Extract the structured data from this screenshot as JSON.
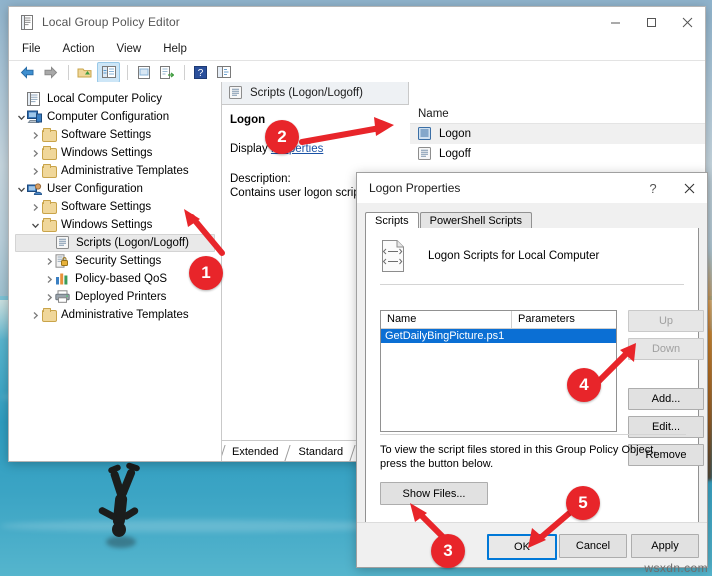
{
  "desktop": {
    "watermark": "wsxdn.com"
  },
  "gpe_window": {
    "title": "Local Group Policy Editor",
    "title_icon": "policy-editor-icon",
    "window_buttons": [
      {
        "name": "minimize-button",
        "glyph": "minimize"
      },
      {
        "name": "maximize-button",
        "glyph": "maximize"
      },
      {
        "name": "close-button",
        "glyph": "close"
      }
    ],
    "menus": [
      "File",
      "Action",
      "View",
      "Help"
    ],
    "toolbar": [
      {
        "name": "back-button",
        "icon": "back-arrow-icon"
      },
      {
        "name": "forward-button",
        "icon": "forward-arrow-icon"
      },
      {
        "name": "up-folder-button",
        "icon": "up-folder-icon"
      },
      {
        "name": "show-tree-button",
        "icon": "show-tree-icon",
        "selected": true
      },
      {
        "name": "properties-button",
        "icon": "properties-icon"
      },
      {
        "name": "export-list-button",
        "icon": "export-list-icon"
      },
      {
        "name": "help-button",
        "icon": "help-icon"
      },
      {
        "name": "show-details-button",
        "icon": "show-details-icon"
      }
    ],
    "tree": [
      {
        "label": "Local Computer Policy",
        "depth": 0,
        "chevron": "",
        "icon": "policy-icon",
        "selected": false
      },
      {
        "label": "Computer Configuration",
        "depth": 0,
        "chevron": "expanded",
        "icon": "computer-icon",
        "selected": false
      },
      {
        "label": "Software Settings",
        "depth": 1,
        "chevron": "collapsed",
        "icon": "folder-icon",
        "selected": false
      },
      {
        "label": "Windows Settings",
        "depth": 1,
        "chevron": "collapsed",
        "icon": "folder-icon",
        "selected": false
      },
      {
        "label": "Administrative Templates",
        "depth": 1,
        "chevron": "collapsed",
        "icon": "folder-icon",
        "selected": false
      },
      {
        "label": "User Configuration",
        "depth": 0,
        "chevron": "expanded",
        "icon": "user-icon",
        "selected": false
      },
      {
        "label": "Software Settings",
        "depth": 1,
        "chevron": "collapsed",
        "icon": "folder-icon",
        "selected": false
      },
      {
        "label": "Windows Settings",
        "depth": 1,
        "chevron": "expanded",
        "icon": "folder-icon",
        "selected": false
      },
      {
        "label": "Scripts (Logon/Logoff)",
        "depth": 2,
        "chevron": "",
        "icon": "scripts-icon",
        "selected": true
      },
      {
        "label": "Security Settings",
        "depth": 2,
        "chevron": "collapsed",
        "icon": "security-icon",
        "selected": false
      },
      {
        "label": "Policy-based QoS",
        "depth": 2,
        "chevron": "collapsed",
        "icon": "qos-icon",
        "selected": false
      },
      {
        "label": "Deployed Printers",
        "depth": 2,
        "chevron": "collapsed",
        "icon": "printer-icon",
        "selected": false
      },
      {
        "label": "Administrative Templates",
        "depth": 1,
        "chevron": "collapsed",
        "icon": "folder-icon",
        "selected": false
      }
    ],
    "right_pane": {
      "tab_label": "Scripts (Logon/Logoff)",
      "tab_icon": "scripts-icon",
      "heading": "Logon",
      "display_label": "Display",
      "display_link": "Properties",
      "description_label": "Description:",
      "description_text": "Contains user logon scripts.",
      "column_header": "Name",
      "items": [
        {
          "label": "Logon",
          "icon": "logon-script-icon",
          "highlighted": true
        },
        {
          "label": "Logoff",
          "icon": "logoff-script-icon",
          "highlighted": false
        }
      ]
    },
    "bottom_tabs": [
      {
        "label": "Extended",
        "active": false
      },
      {
        "label": "Standard",
        "active": true
      }
    ]
  },
  "dialog": {
    "title": "Logon Properties",
    "help_button": "?",
    "close_button": "close-icon",
    "tabs": [
      {
        "label": "Scripts",
        "active": true
      },
      {
        "label": "PowerShell Scripts",
        "active": false
      }
    ],
    "header_text": "Logon Scripts for Local Computer",
    "header_icon": "script-document-icon",
    "list_columns": [
      "Name",
      "Parameters"
    ],
    "list_rows": [
      {
        "name": "GetDailyBingPicture.ps1",
        "parameters": "",
        "selected": true
      }
    ],
    "side_buttons": [
      {
        "label": "Up",
        "enabled": false
      },
      {
        "label": "Down",
        "enabled": false
      },
      {
        "label": "Add...",
        "enabled": true
      },
      {
        "label": "Edit...",
        "enabled": true
      },
      {
        "label": "Remove",
        "enabled": true
      }
    ],
    "note_text": "To view the script files stored in this Group Policy Object, press the button below.",
    "show_files_label": "Show Files...",
    "footer_buttons": [
      {
        "label": "OK",
        "focused": true
      },
      {
        "label": "Cancel",
        "focused": false
      },
      {
        "label": "Apply",
        "focused": false
      }
    ]
  },
  "callouts": [
    {
      "number": "1"
    },
    {
      "number": "2"
    },
    {
      "number": "3"
    },
    {
      "number": "4"
    },
    {
      "number": "5"
    }
  ],
  "colors": {
    "accent": "#0078d7",
    "callout_red": "#e8252a",
    "selection_blue": "#0b6fd4",
    "link_blue": "#1a52a5"
  }
}
